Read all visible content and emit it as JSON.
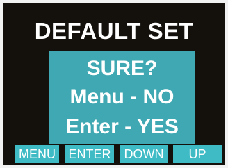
{
  "title": "DEFAULT SET",
  "dialog": {
    "line1": "SURE?",
    "line2": "Menu - NO",
    "line3": "Enter - YES"
  },
  "softkeys": {
    "menu": "MENU",
    "enter": "ENTER",
    "down": "DOWN",
    "up": "UP"
  },
  "colors": {
    "screen_background": "#14100c",
    "dialog_background": "#3fa8b2",
    "softkey_background": "#3fbbc6",
    "text": "#ffffff"
  }
}
